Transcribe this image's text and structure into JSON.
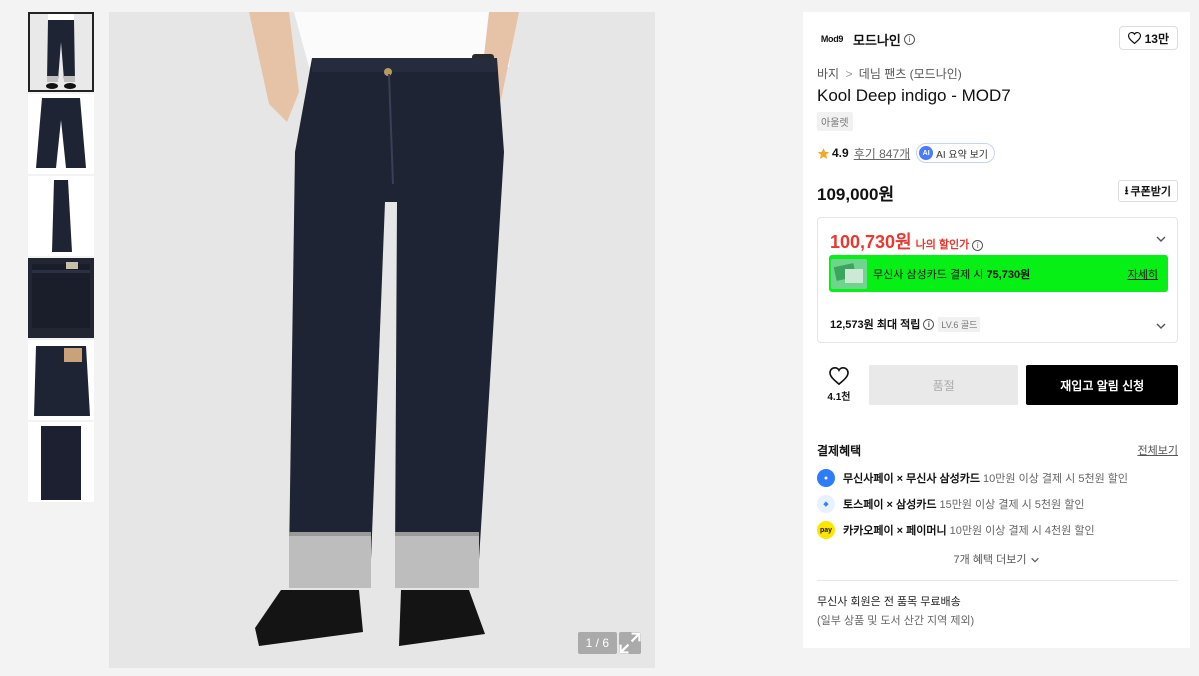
{
  "gallery": {
    "thumbnails": [
      "thumb-1",
      "thumb-2",
      "thumb-3",
      "thumb-4",
      "thumb-5",
      "thumb-6"
    ],
    "counter": "1 / 6"
  },
  "brand": {
    "logo_text": "Mod9",
    "name": "모드나인",
    "like_count": "13만"
  },
  "breadcrumb": {
    "level1": "바지",
    "separator": ">",
    "level2": "데님 팬츠 (모드나인)"
  },
  "product": {
    "title": "Kool Deep indigo - MOD7",
    "tag": "아울렛",
    "rating": "4.9",
    "reviews": "후기 847개",
    "ai_summary": "AI 요약 보기",
    "price": "109,000원",
    "coupon_label": "쿠폰받기"
  },
  "discount": {
    "my_price": "100,730원",
    "my_price_label": "나의 할인가",
    "card_text": "무신사 삼성카드 결제 시",
    "card_price": "75,730원",
    "card_more": "자세히",
    "points": "12,573원 최대 적립",
    "level": "LV.6 골드"
  },
  "actions": {
    "like_count": "4.1천",
    "soldout": "품절",
    "restock": "재입고 알림 신청"
  },
  "benefits": {
    "heading": "결제혜택",
    "see_all": "전체보기",
    "items": [
      {
        "name": "무신사페이 × 무신사 삼성카드",
        "detail": "10만원 이상 결제 시 5천원 할인",
        "icon": "musinsa-pay-icon",
        "color": "#2e7cf6"
      },
      {
        "name": "토스페이 × 삼성카드",
        "detail": "15만원 이상 결제 시 5천원 할인",
        "icon": "toss-pay-icon",
        "color": "#3182f6"
      },
      {
        "name": "카카오페이 × 페이머니",
        "detail": "10만원 이상 결제 시 4천원 할인",
        "icon": "kakao-pay-icon",
        "color": "#fee500"
      }
    ],
    "more": "7개 혜택 더보기"
  },
  "shipping": {
    "line1": "무신사 회원은 전 품목 무료배송",
    "line2": "(일부 상품 및 도서 산간 지역 제외)"
  },
  "colors": {
    "accent_red": "#e8382f",
    "card_green": "#06f016",
    "denim": "#1f2434"
  }
}
